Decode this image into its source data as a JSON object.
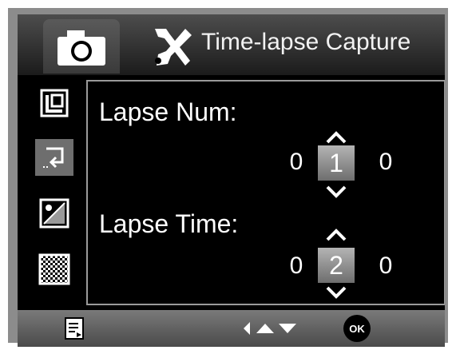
{
  "header": {
    "title": "Time-lapse Capture",
    "tabs": [
      {
        "name": "camera",
        "icon": "camera-icon",
        "active": true
      },
      {
        "name": "tools",
        "icon": "tools-icon",
        "active": false
      }
    ]
  },
  "sidebar": {
    "items": [
      {
        "icon": "resolution-icon"
      },
      {
        "icon": "time-lapse-icon",
        "active": true
      },
      {
        "icon": "exposure-icon"
      },
      {
        "icon": "quality-icon"
      }
    ]
  },
  "settings": {
    "lapse_num": {
      "label": "Lapse Num:",
      "digits": [
        "0",
        "1",
        "0"
      ],
      "selected_index": 1
    },
    "lapse_time": {
      "label": "Lapse Time:",
      "digits": [
        "0",
        "2",
        "0"
      ],
      "selected_index": 1
    }
  },
  "bottom_bar": {
    "menu_icon": "menu-icon",
    "nav_icons": [
      "left-arrow-icon",
      "up-arrow-icon",
      "down-arrow-icon"
    ],
    "ok_label": "OK"
  },
  "colors": {
    "background": "#000000",
    "highlight": "#8c8c8c",
    "text": "#ffffff"
  }
}
